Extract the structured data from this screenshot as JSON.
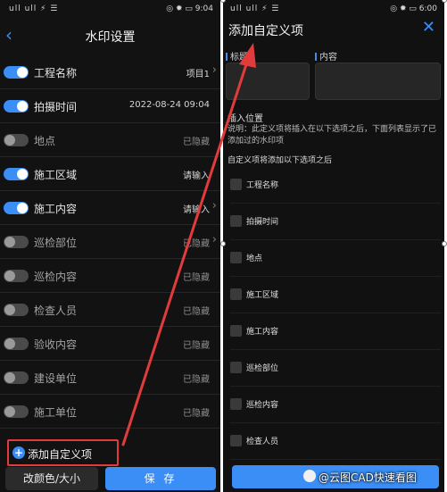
{
  "left_phone": {
    "status_bar": {
      "left": "ull ull ⚡ ☰",
      "right": "◎ ✹ ▭ 9:04"
    },
    "title": "水印设置",
    "back_icon": "chevron-left-icon",
    "rows": [
      {
        "label": "工程名称",
        "value": "项目1",
        "enabled": true,
        "chevron": true
      },
      {
        "label": "拍摄时间",
        "value": "2022-08-24 09:04",
        "enabled": true,
        "chevron": false
      },
      {
        "label": "地点",
        "value": "已隐藏",
        "enabled": false,
        "chevron": false
      },
      {
        "label": "施工区域",
        "value": "请输入",
        "enabled": true,
        "chevron": false
      },
      {
        "label": "施工内容",
        "value": "请输入",
        "enabled": true,
        "chevron": true
      },
      {
        "label": "巡检部位",
        "value": "已隐藏",
        "enabled": false,
        "chevron": true
      },
      {
        "label": "巡检内容",
        "value": "已隐藏",
        "enabled": false,
        "chevron": false
      },
      {
        "label": "检查人员",
        "value": "已隐藏",
        "enabled": false,
        "chevron": false
      },
      {
        "label": "验收内容",
        "value": "已隐藏",
        "enabled": false,
        "chevron": false
      },
      {
        "label": "建设单位",
        "value": "已隐藏",
        "enabled": false,
        "chevron": false
      },
      {
        "label": "施工单位",
        "value": "已隐藏",
        "enabled": false,
        "chevron": false
      }
    ],
    "add_custom": "添加自定义项",
    "color_size_button": "改颜色/大小",
    "save_button": "保 存"
  },
  "right_phone": {
    "status_bar": {
      "left": "ull ull ⚡ ☰",
      "right": "◎ ✹ ▭ 6:00"
    },
    "title": "添加自定义项",
    "close_icon": "close-icon",
    "title_field_label": "标题",
    "content_field_label": "内容",
    "insert_position_label": "插入位置",
    "description": "说明：此定义项将插入在以下选项之后，下面列表显示了已添加过的水印项",
    "after_label": "自定义项将添加以下选项之后",
    "options": [
      "工程名称",
      "拍摄时间",
      "地点",
      "施工区域",
      "施工内容",
      "巡检部位",
      "巡检内容",
      "检查人员"
    ]
  },
  "watermark": "@云图CAD快速看图",
  "colors": {
    "accent": "#3a8ef6",
    "highlight": "#e23b3b",
    "background": "#121212"
  }
}
